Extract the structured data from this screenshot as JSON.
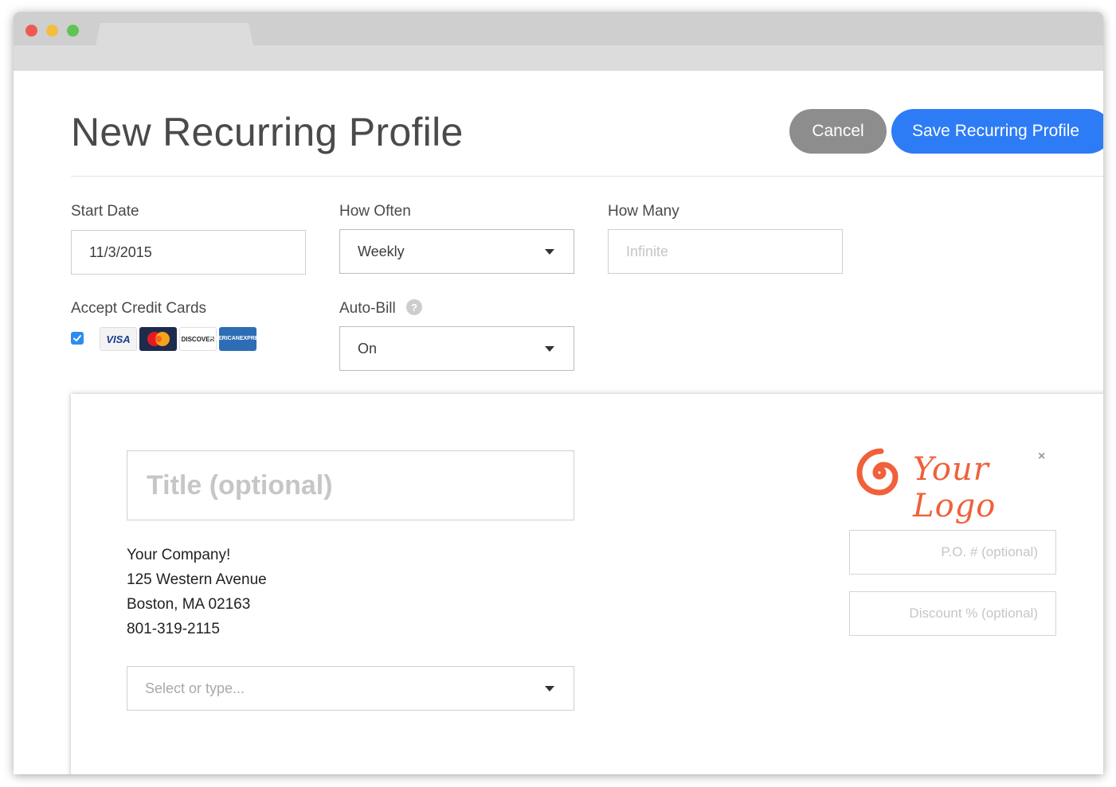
{
  "page": {
    "title": "New Recurring Profile",
    "cancel_label": "Cancel",
    "save_label": "Save Recurring Profile"
  },
  "fields": {
    "start_date": {
      "label": "Start Date",
      "value": "11/3/2015"
    },
    "how_often": {
      "label": "How Often",
      "value": "Weekly"
    },
    "how_many": {
      "label": "How Many",
      "placeholder": "Infinite"
    },
    "accept_cards": {
      "label": "Accept Credit Cards",
      "checked": true
    },
    "auto_bill": {
      "label": "Auto-Bill",
      "value": "On",
      "help": "?"
    }
  },
  "cards": {
    "visa": "VISA",
    "mastercard": "MasterCard",
    "discover": "DISCOVER",
    "amex_top": "AMERICAN",
    "amex_bottom": "EXPRESS"
  },
  "invoice": {
    "title_placeholder": "Title (optional)",
    "company": [
      "Your Company!",
      "125 Western Avenue",
      "Boston, MA 02163",
      "801-319-2115"
    ],
    "client_placeholder": "Select or type...",
    "logo_text": "Your Logo",
    "logo_close": "×",
    "po_placeholder": "P.O. # (optional)",
    "discount_placeholder": "Discount % (optional)"
  },
  "colors": {
    "primary": "#2d7cf6",
    "cancel": "#8d8d8d",
    "logo": "#f0603a"
  }
}
